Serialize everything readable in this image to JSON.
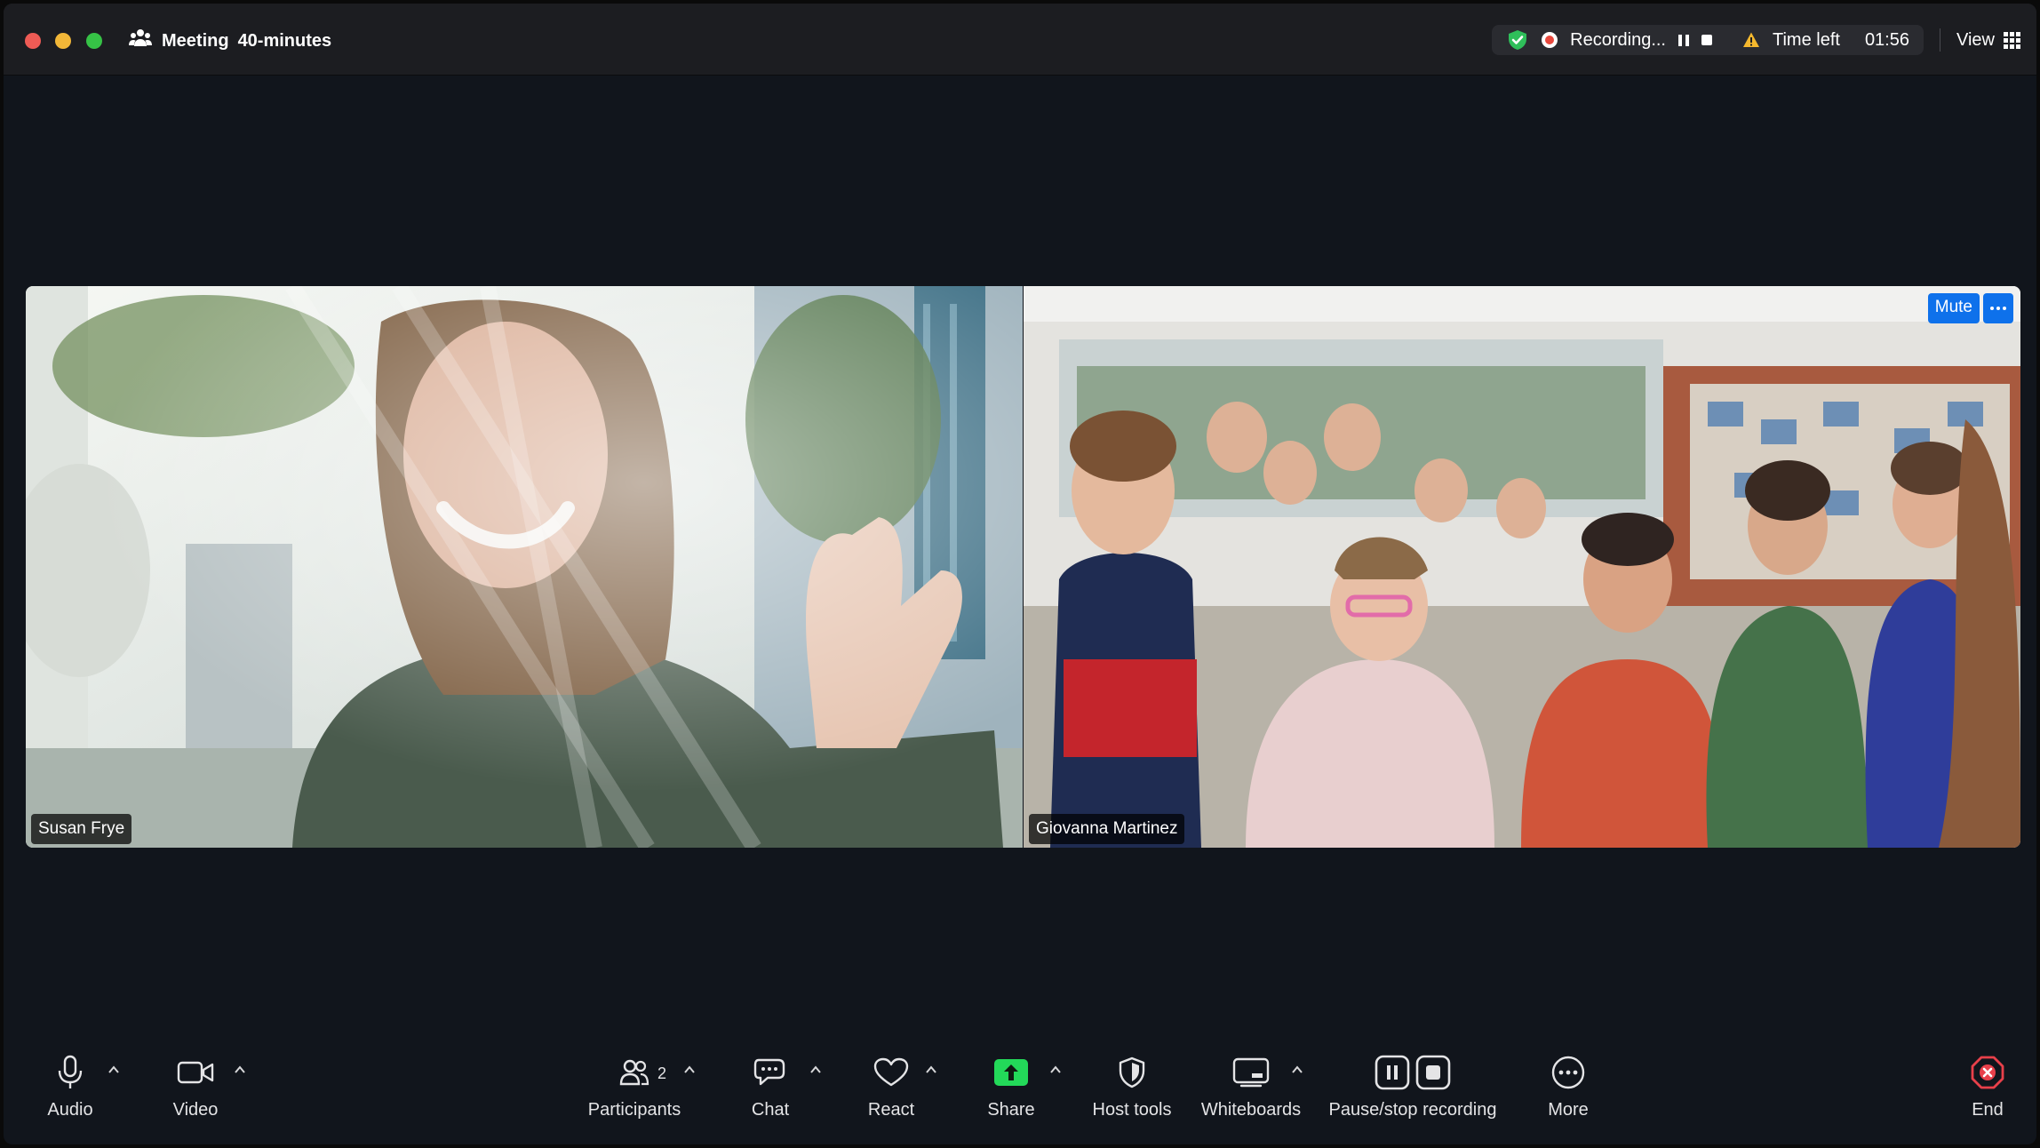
{
  "title_bar": {
    "meeting_label": "Meeting",
    "meeting_duration": "40-minutes",
    "recording_label": "Recording...",
    "time_left_label": "Time left",
    "time_left_value": "01:56",
    "view_label": "View"
  },
  "tiles": [
    {
      "name": "Susan Frye"
    },
    {
      "name": "Giovanna Martinez",
      "mute_label": "Mute"
    }
  ],
  "toolbar": {
    "audio": "Audio",
    "video": "Video",
    "participants": "Participants",
    "participants_count": "2",
    "chat": "Chat",
    "react": "React",
    "share": "Share",
    "host_tools": "Host tools",
    "whiteboards": "Whiteboards",
    "pause_stop_recording": "Pause/stop recording",
    "more": "More",
    "end": "End"
  },
  "colors": {
    "share_green": "#23d959",
    "shield_green": "#2fbf5a",
    "mute_blue": "#0e71eb",
    "end_red": "#e8404a"
  }
}
